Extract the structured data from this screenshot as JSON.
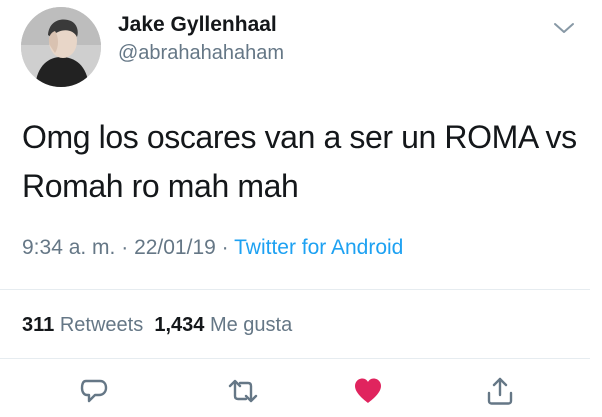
{
  "author": {
    "name": "Jake Gyllenhaal",
    "handle": "@abrahahahaham"
  },
  "tweet": {
    "text_line1": "Omg los oscares van a ser un ROMA vs",
    "text_line2": "Romah ro mah mah"
  },
  "meta": {
    "time": "9:34 a. m.",
    "sep1": " · ",
    "date": "22/01/19",
    "sep2": " · ",
    "source": "Twitter for Android"
  },
  "stats": {
    "retweets_count": "311",
    "retweets_label": "Retweets",
    "likes_count": "1,434",
    "likes_label": "Me gusta"
  },
  "actions": {
    "reply_icon": "reply-icon",
    "retweet_icon": "retweet-icon",
    "like_icon": "heart-icon",
    "share_icon": "share-icon"
  },
  "colors": {
    "like_active": "#e0245e",
    "link": "#1da1f2",
    "secondary_text": "#657786",
    "primary_text": "#14171a"
  }
}
